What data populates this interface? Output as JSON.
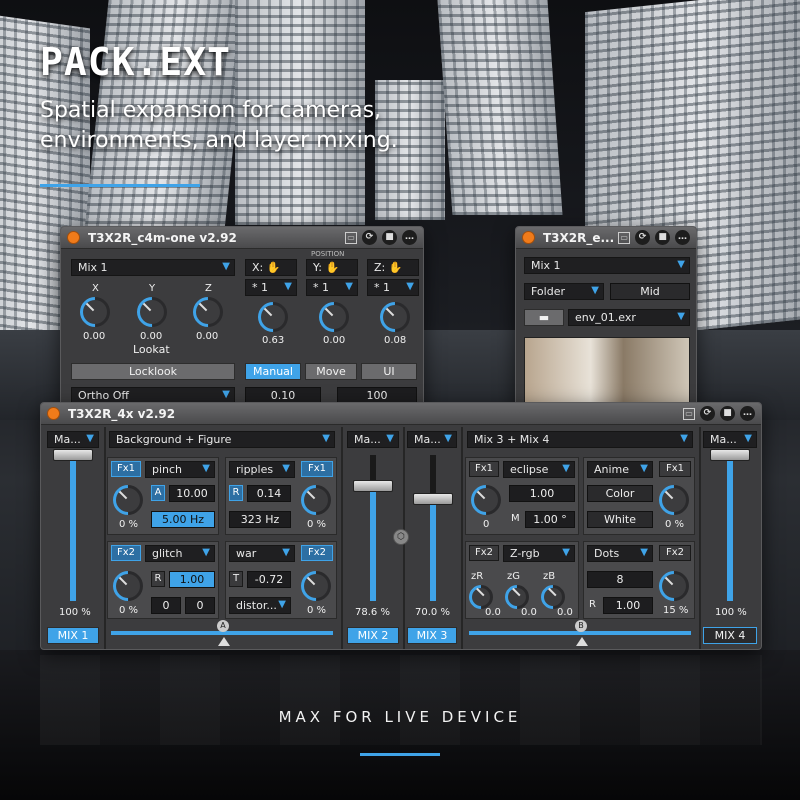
{
  "headline": {
    "brand": "PACK.EXT",
    "tagline": "Spatial expansion for cameras, environments, and layer mixing."
  },
  "footer": {
    "text": "MAX FOR LIVE DEVICE"
  },
  "colors": {
    "accent": "#3fa3e8",
    "orange": "#f07b1a",
    "panel": "#3c3c3e"
  },
  "icons": {
    "power": "power-icon",
    "save": "floppy-icon",
    "more": "ellipsis-icon",
    "hand": "hand-icon",
    "folder": "folder-icon"
  },
  "cam": {
    "title": "T3X2R_c4m-one v2.92",
    "mix_select": "Mix 1",
    "position_label": "POSITION",
    "lookat": {
      "label": "Lookat",
      "knobs": [
        {
          "axis": "X",
          "value": "0.00"
        },
        {
          "axis": "Y",
          "value": "0.00"
        },
        {
          "axis": "Z",
          "value": "0.00"
        }
      ]
    },
    "position": {
      "axes": [
        {
          "axis": "X:",
          "mult": "* 1",
          "value": "0.63"
        },
        {
          "axis": "Y:",
          "mult": "* 1",
          "value": "0.00"
        },
        {
          "axis": "Z:",
          "mult": "* 1",
          "value": "0.08"
        }
      ]
    },
    "locklook": "Locklook",
    "ortho": "Ortho Off",
    "modes": [
      "Manual",
      "Move",
      "UI"
    ],
    "bottom_values": [
      "0.10",
      "100"
    ]
  },
  "env": {
    "title": "T3X2R_e...",
    "mix_select": "Mix 1",
    "source": "Folder",
    "position": "Mid",
    "file": "env_01.exr"
  },
  "mixer": {
    "title": "T3X2R_4x v2.92",
    "channels": [
      {
        "select": "Ma...",
        "percent": "100 %",
        "name": "MIX 1",
        "level": 1.0
      },
      {
        "select": "Ma...",
        "percent": "78.6 %",
        "name": "MIX 2",
        "level": 0.786
      },
      {
        "select": "Ma...",
        "percent": "70.0 %",
        "name": "MIX 3",
        "level": 0.7
      },
      {
        "select": "Ma...",
        "percent": "100 %",
        "name": "MIX 4",
        "level": 1.0
      }
    ],
    "left_pair": {
      "header": "Background + Figure",
      "crossfader": "A",
      "fx1_left": {
        "tag": "Fx1",
        "effect": "pinch",
        "knob": "0 %",
        "a_label": "A",
        "a_value": "10.00",
        "freq": "5.00 Hz"
      },
      "fx2_left": {
        "tag": "Fx2",
        "effect": "glitch",
        "knob": "0 %",
        "r_label": "R",
        "r_value": "1.00",
        "v1": "0",
        "v2": "0"
      },
      "fx1_right": {
        "tag": "Fx1",
        "effect": "ripples",
        "knob": "0 %",
        "r_label": "R",
        "r_value": "0.14",
        "freq": "323 Hz"
      },
      "fx2_right": {
        "tag": "Fx2",
        "effect": "war",
        "knob": "0 %",
        "t_label": "T",
        "t_value": "-0.72",
        "extra": "distor..."
      }
    },
    "right_pair": {
      "header_a": "Mix 3",
      "plus": "+",
      "header_b": "Mix 4",
      "crossfader": "B",
      "fx1_left": {
        "tag": "Fx1",
        "effect": "eclipse",
        "knob": "0",
        "v1": "1.00",
        "m_label": "M",
        "m_value": "1.00 °"
      },
      "fx2_left": {
        "tag": "Fx2",
        "effect": "Z-rgb",
        "knobs": [
          {
            "label": "zR",
            "value": "0.0"
          },
          {
            "label": "zG",
            "value": "0.0"
          },
          {
            "label": "zB",
            "value": "0.0"
          }
        ]
      },
      "fx1_right": {
        "tag": "Fx1",
        "effect": "Anime",
        "knob": "0 %",
        "b1": "Color",
        "b2": "White"
      },
      "fx2_right": {
        "tag": "Fx2",
        "effect": "Dots",
        "knob": "15 %",
        "v1": "8",
        "r_label": "R",
        "r_value": "1.00"
      }
    }
  }
}
